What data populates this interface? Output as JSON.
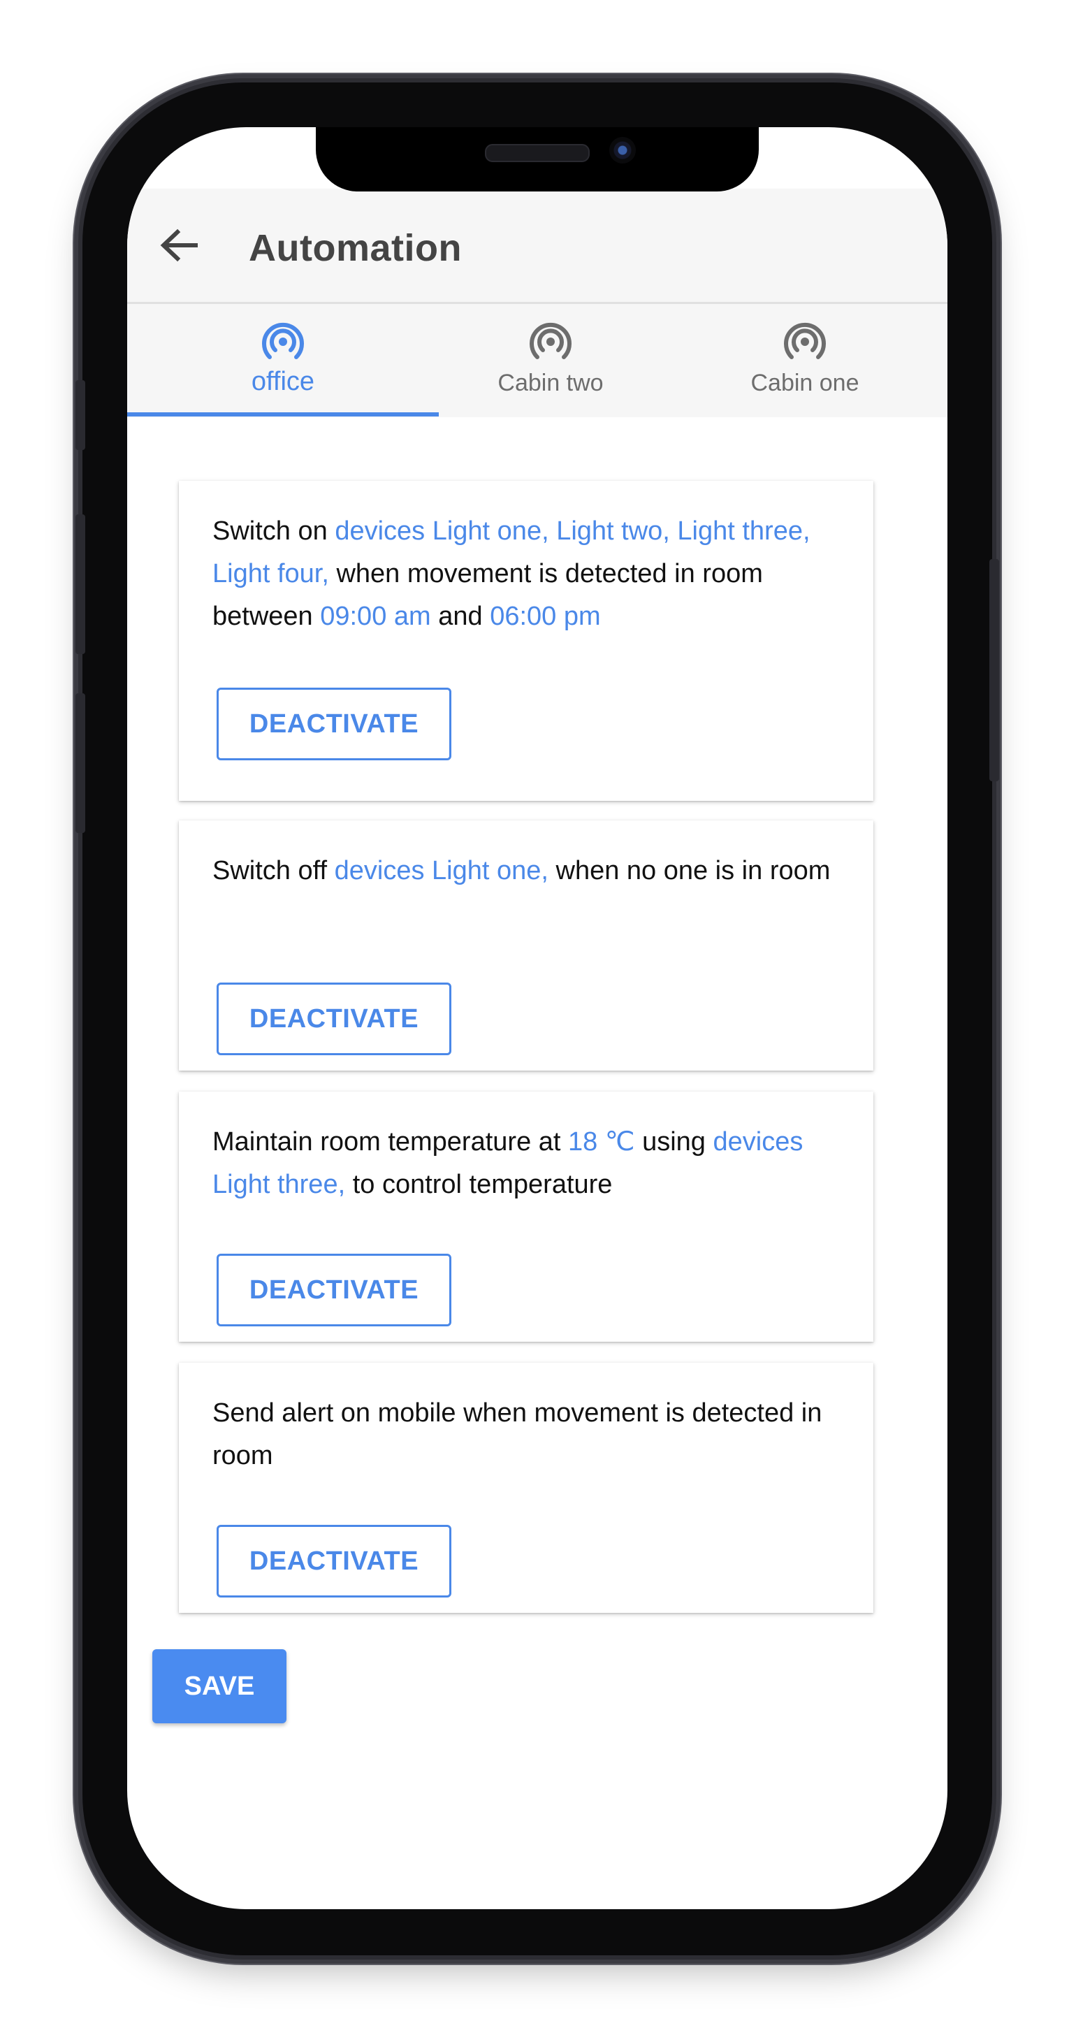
{
  "app": {
    "title": "Automation"
  },
  "tabs": [
    {
      "label": "office",
      "active": true
    },
    {
      "label": "Cabin two",
      "active": false
    },
    {
      "label": "Cabin one",
      "active": false
    }
  ],
  "rules": [
    {
      "segments": [
        {
          "text": "Switch on ",
          "highlight": false
        },
        {
          "text": "devices Light one, Light two, Light three, Light four,",
          "highlight": true
        },
        {
          "text": " when movement is detected in room between ",
          "highlight": false
        },
        {
          "text": "09:00 am",
          "highlight": true
        },
        {
          "text": " and ",
          "highlight": false
        },
        {
          "text": "06:00 pm",
          "highlight": true
        }
      ],
      "button_label": "DEACTIVATE"
    },
    {
      "segments": [
        {
          "text": "Switch off ",
          "highlight": false
        },
        {
          "text": "devices Light one,",
          "highlight": true
        },
        {
          "text": " when no one is in room",
          "highlight": false
        }
      ],
      "button_label": "DEACTIVATE"
    },
    {
      "segments": [
        {
          "text": "Maintain room temperature at ",
          "highlight": false
        },
        {
          "text": "18 ℃",
          "highlight": true
        },
        {
          "text": " using ",
          "highlight": false
        },
        {
          "text": "devices Light three,",
          "highlight": true
        },
        {
          "text": " to control temperature",
          "highlight": false
        }
      ],
      "button_label": "DEACTIVATE"
    },
    {
      "segments": [
        {
          "text": "Send alert on mobile when movement is detected in room",
          "highlight": false
        }
      ],
      "button_label": "DEACTIVATE"
    }
  ],
  "save_label": "SAVE",
  "colors": {
    "accent": "#4a88e8",
    "save": "#4a8bf0",
    "appbar": "#f6f6f6"
  },
  "icons": {
    "back": "arrow-left-icon",
    "tab": "broadcast-signal-icon"
  }
}
